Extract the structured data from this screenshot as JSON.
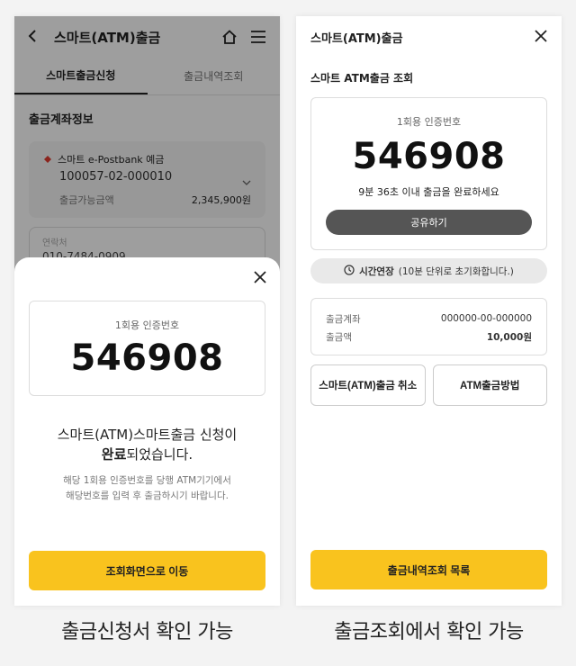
{
  "left": {
    "header": {
      "title": "스마트(ATM)출금"
    },
    "tabs": [
      {
        "label": "스마트출금신청",
        "active": true
      },
      {
        "label": "출금내역조회",
        "active": false
      }
    ],
    "section_title": "출금계좌정보",
    "account": {
      "name": "스마트 e-Postbank 예금",
      "number": "100057-02-000010",
      "balance_label": "출금가능금액",
      "balance": "2,345,900원"
    },
    "contact": {
      "label": "연락처",
      "value": "010-7484-0909"
    },
    "sheet": {
      "code_label": "1회용 인증번호",
      "code": "546908",
      "msg_line1": "스마트(ATM)스마트출금 신청이",
      "msg_bold": "완료",
      "msg_rest": "되었습니다.",
      "sub_line1": "해당 1회용 인증번호를 당행 ATM기기에서",
      "sub_line2": "해당번호를 입력 후 출금하시기 바랍니다.",
      "button": "조회화면으로 이동"
    },
    "caption": "출금신청서 확인 가능"
  },
  "right": {
    "header": {
      "title": "스마트(ATM)출금"
    },
    "section_title": "스마트 ATM출금 조회",
    "code_label": "1회용 인증번호",
    "code": "546908",
    "time_text": "9분 36초 이내 출금을 완료하세요",
    "share_button": "공유하기",
    "extend": {
      "bold": "시간연장",
      "rest": "(10분 단위로 초기화합니다.)"
    },
    "info": [
      {
        "label": "출금계좌",
        "value": "000000-00-000000",
        "bold": false
      },
      {
        "label": "출금액",
        "value": "10,000원",
        "bold": true
      }
    ],
    "cancel_button": "스마트(ATM)출금 취소",
    "method_button": "ATM출금방법",
    "list_button": "출금내역조회 목록",
    "caption": "출금조회에서 확인 가능"
  },
  "colors": {
    "accent_yellow": "#f9c31e",
    "share_gray": "#555555",
    "pill_gray": "#e9e9e9"
  },
  "icons": [
    "back-arrow-icon",
    "home-icon",
    "menu-icon",
    "close-icon",
    "clock-icon",
    "chevron-down-icon",
    "bank-logo-icon"
  ]
}
